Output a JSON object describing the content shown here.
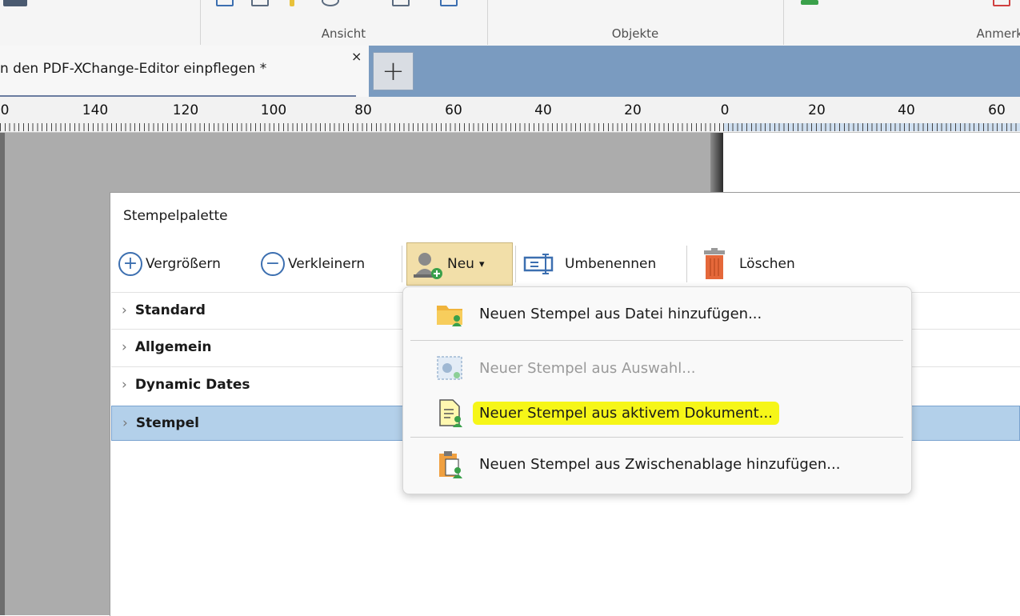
{
  "ribbon": {
    "sections": [
      {
        "label": "Ansicht"
      },
      {
        "label": "Objekte"
      },
      {
        "label": "Anmerk"
      }
    ]
  },
  "tabs": {
    "active_title": "n den PDF-XChange-Editor einpflegen *",
    "close_glyph": "×",
    "new_tab_glyph": "+"
  },
  "ruler": {
    "labels": [
      "0",
      "140",
      "120",
      "100",
      "80",
      "60",
      "40",
      "20",
      "0",
      "20",
      "40",
      "60"
    ]
  },
  "palette": {
    "title": "Stempelpalette",
    "toolbar": {
      "enlarge": "Vergrößern",
      "shrink": "Verkleinern",
      "new": "Neu",
      "rename": "Umbenennen",
      "delete": "Löschen"
    },
    "categories": [
      {
        "label": "Standard"
      },
      {
        "label": "Allgemein"
      },
      {
        "label": "Dynamic Dates"
      },
      {
        "label": "Stempel",
        "selected": true
      }
    ]
  },
  "new_menu": {
    "items": [
      {
        "label": "Neuen Stempel aus Datei hinzufügen...",
        "icon": "folder-user-icon",
        "enabled": true
      },
      {
        "label": "Neuer Stempel aus Auswahl...",
        "icon": "image-selection-icon",
        "enabled": false
      },
      {
        "label": "Neuer Stempel aus aktivem Dokument...",
        "icon": "document-user-icon",
        "enabled": true,
        "highlighted": true
      },
      {
        "label": "Neuen Stempel aus Zwischenablage hinzufügen...",
        "icon": "clipboard-user-icon",
        "enabled": true
      }
    ]
  },
  "colors": {
    "tabstrip": "#7a9bc0",
    "highlight": "#f6f618",
    "selected_row": "#b3d0ea",
    "new_button": "#f2dfa9"
  }
}
